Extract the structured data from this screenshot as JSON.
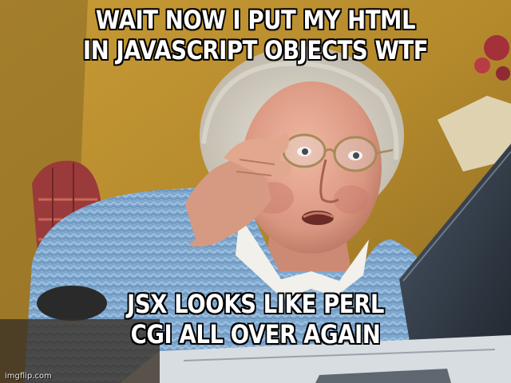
{
  "meme": {
    "top_text": [
      "WAIT NOW I PUT MY HTML",
      "IN JAVASCRIPT OBJECTS WTF"
    ],
    "bottom_text": [
      "JSX LOOKS LIKE PERL",
      "CGI ALL OVER AGAIN"
    ],
    "watermark": "imgflip.com"
  }
}
